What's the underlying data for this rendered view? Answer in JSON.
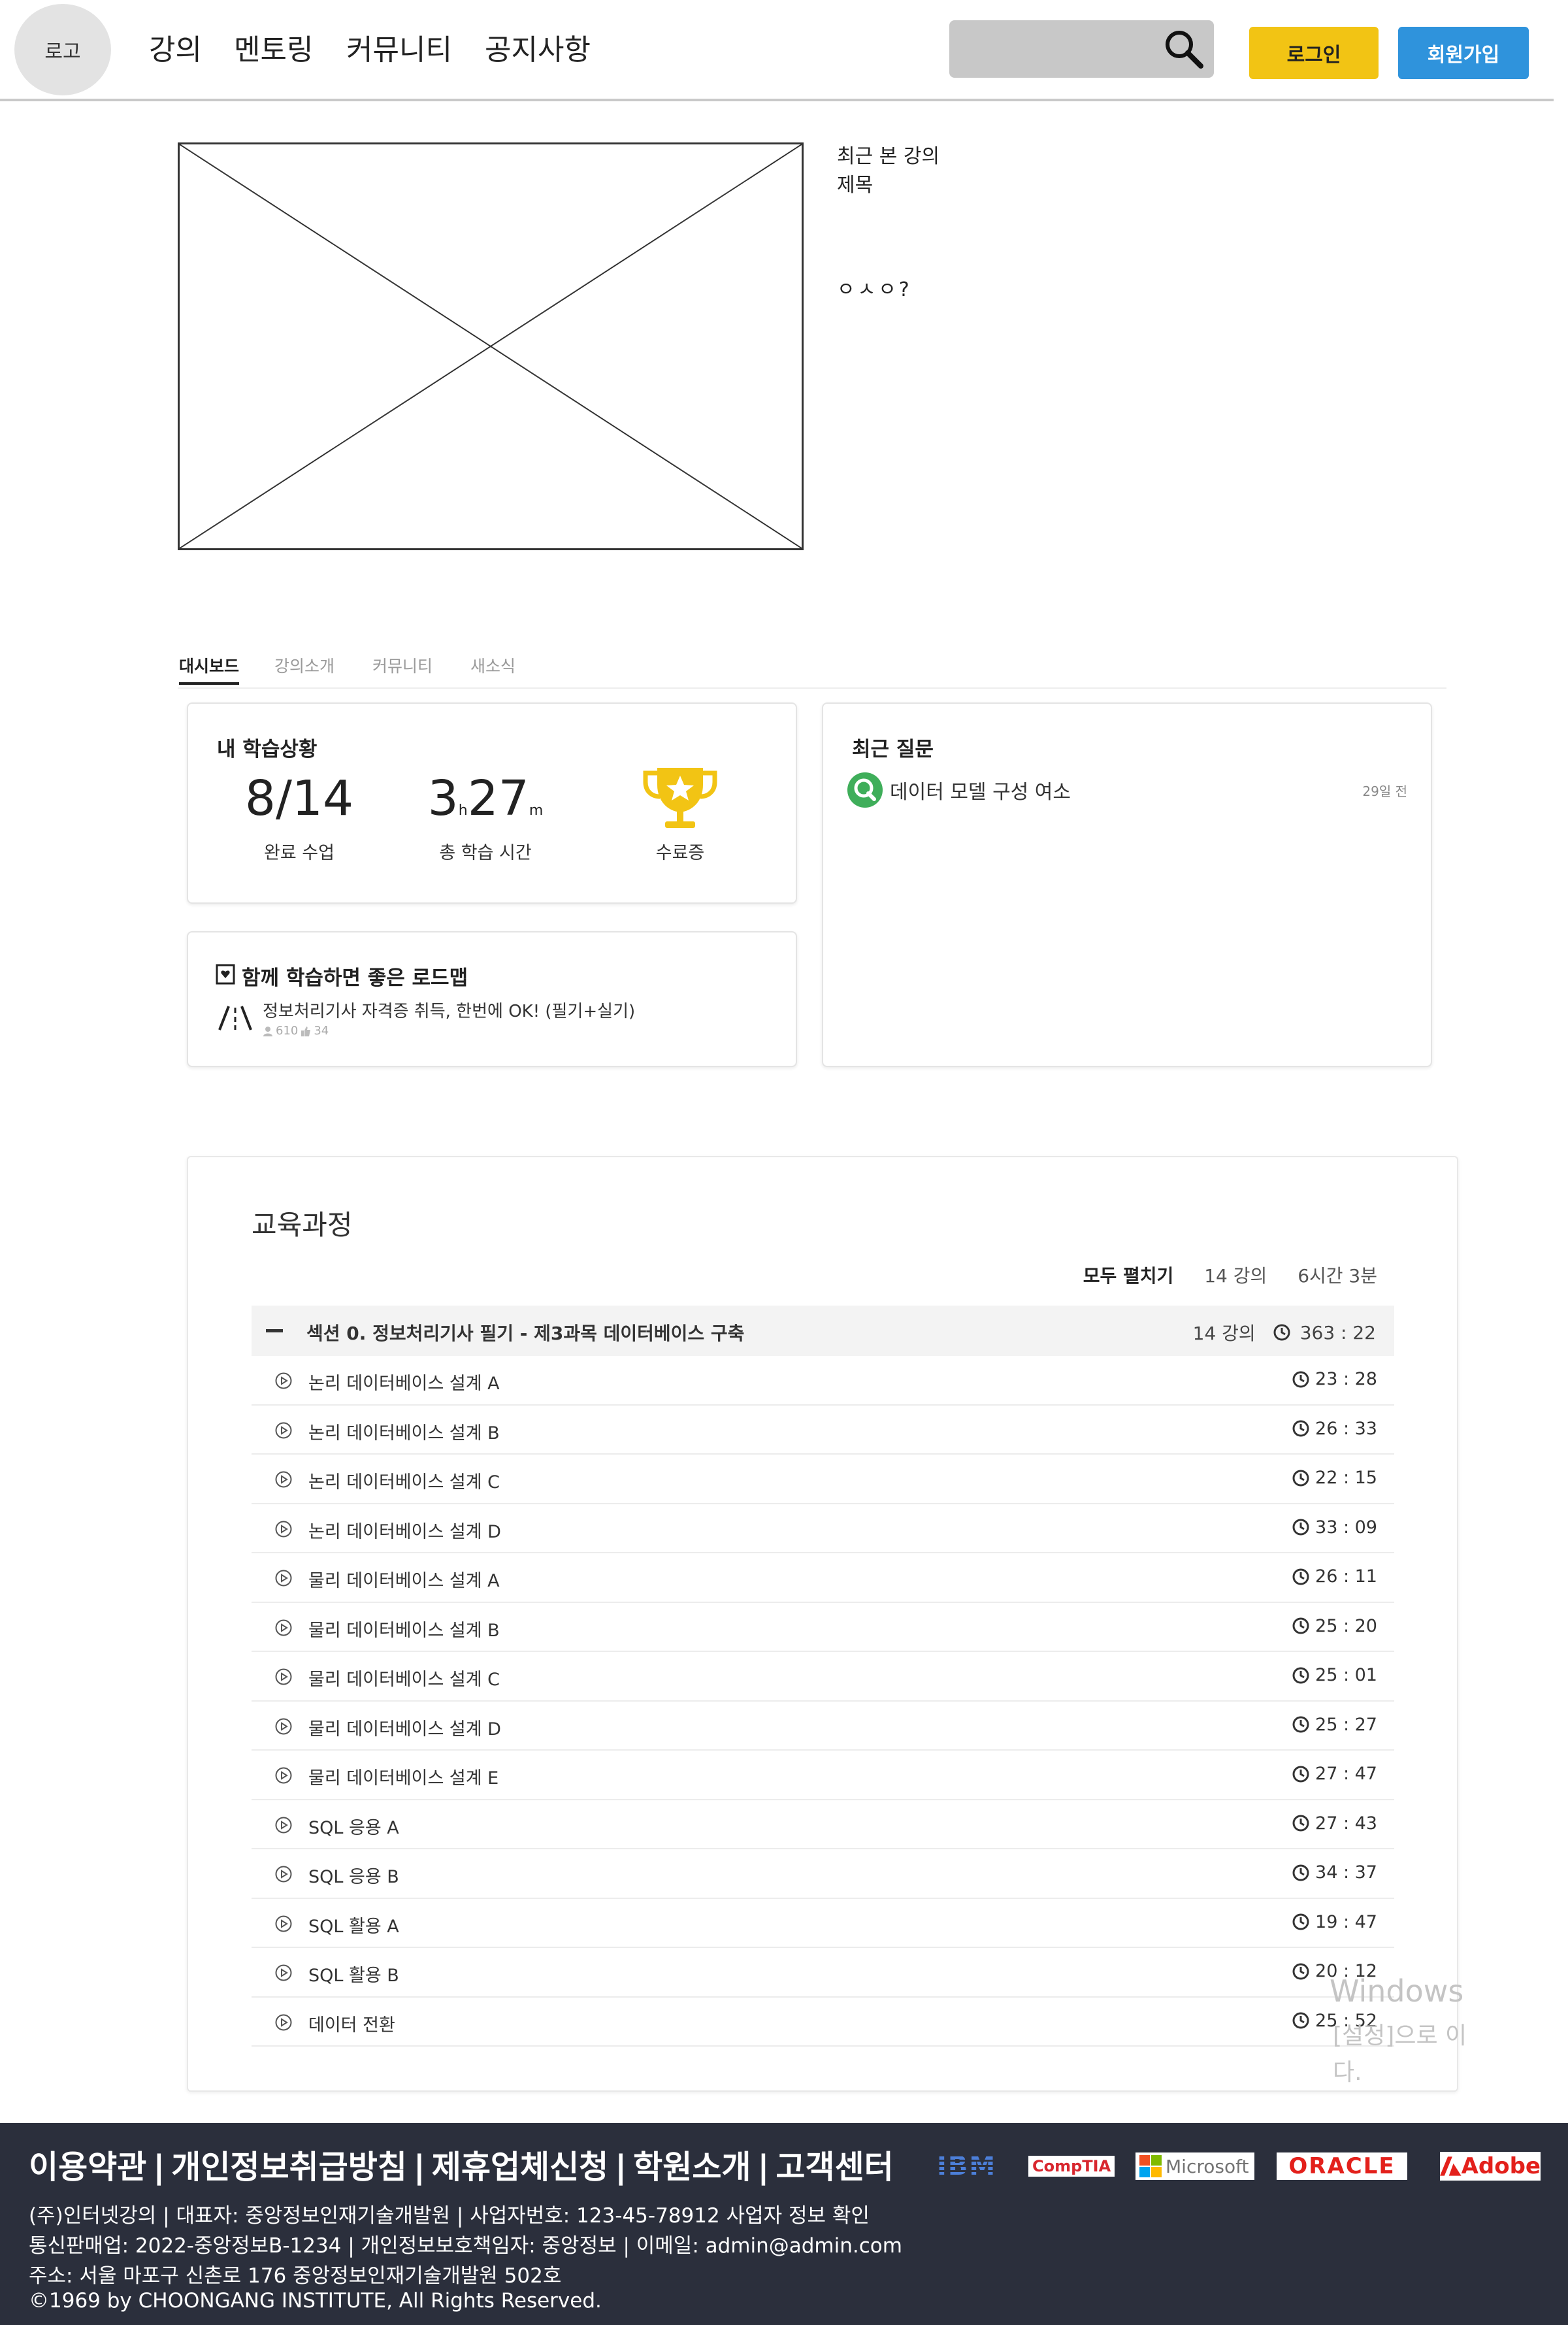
{
  "header": {
    "logo": "로고",
    "nav": [
      "강의",
      "멘토링",
      "커뮤니티",
      "공지사항"
    ],
    "login": "로그인",
    "signup": "회원가입"
  },
  "hero": {
    "line1": "최근 본 강의",
    "line2": "제목",
    "line3": "ㅇㅅㅇ?"
  },
  "tabs": [
    "대시보드",
    "강의소개",
    "커뮤니티",
    "새소식"
  ],
  "study": {
    "title": "내 학습상황",
    "completed": "8/14",
    "completed_label": "완료 수업",
    "time_h": "3",
    "time_h_unit": "h",
    "time_m": "27",
    "time_m_unit": "m",
    "time_label": "총 학습 시간",
    "cert_label": "수료증"
  },
  "roadmap": {
    "title": "함께 학습하면 좋은 로드맵",
    "item": "정보처리기사 자격증 취득, 한번에 OK! (필기+실기)",
    "students": "610",
    "likes": "34"
  },
  "questions": {
    "title": "최근 질문",
    "item": "데이터 모델 구성 여소",
    "ago": "29일 전"
  },
  "curriculum": {
    "title": "교육과정",
    "expand_all": "모두 펼치기",
    "count": "14 강의",
    "total_time": "6시간 3분",
    "section": {
      "title": "섹션 0. 정보처리기사 필기 - 제3과목 데이터베이스 구축",
      "count": "14 강의",
      "time": "363 : 22"
    },
    "lessons": [
      {
        "title": "논리 데이터베이스 설계 A",
        "time": "23 : 28"
      },
      {
        "title": "논리 데이터베이스 설계 B",
        "time": "26 : 33"
      },
      {
        "title": "논리 데이터베이스 설계 C",
        "time": "22 : 15"
      },
      {
        "title": "논리 데이터베이스 설계 D",
        "time": "33 : 09"
      },
      {
        "title": "물리 데이터베이스 설계 A",
        "time": "26 : 11"
      },
      {
        "title": "물리 데이터베이스 설계 B",
        "time": "25 : 20"
      },
      {
        "title": "물리 데이터베이스 설계 C",
        "time": "25 : 01"
      },
      {
        "title": "물리 데이터베이스 설계 D",
        "time": "25 : 27"
      },
      {
        "title": "물리 데이터베이스 설계 E",
        "time": "27 : 47"
      },
      {
        "title": "SQL 응용 A",
        "time": "27 : 43"
      },
      {
        "title": "SQL 응용 B",
        "time": "34 : 37"
      },
      {
        "title": "SQL 활용 A",
        "time": "19 : 47"
      },
      {
        "title": "SQL 활용 B",
        "time": "20 : 12"
      },
      {
        "title": "데이터 전환",
        "time": "25 : 52"
      }
    ]
  },
  "watermark": {
    "line1": "Windows",
    "line2": "[설정]으로 이",
    "line3": "다."
  },
  "footer": {
    "links": [
      "이용약관",
      "개인정보취급방침",
      "제휴업체신청",
      "학원소개",
      "고객센터"
    ],
    "brands": [
      "IBM",
      "CompTIA",
      "Microsoft",
      "ORACLE",
      "Adobe"
    ],
    "line1": "(주)인터넷강의 | 대표자: 중앙정보인재기술개발원 | 사업자번호: 123-45-78912 사업자 정보 확인",
    "line2": "통신판매업: 2022-중앙정보B-1234 | 개인정보보호책임자: 중앙정보 | 이메일: admin@admin.com",
    "line3": "주소: 서울 마포구 신촌로 176 중앙정보인재기술개발원 502호",
    "line4": "©1969 by CHOONGANG INSTITUTE, All Rights Reserved."
  },
  "colors": {
    "login": "#f2c414",
    "signup": "#2f93dc",
    "footer": "#2b2f3c",
    "trophy": "#f2c414",
    "question_icon": "#3fae5a"
  }
}
